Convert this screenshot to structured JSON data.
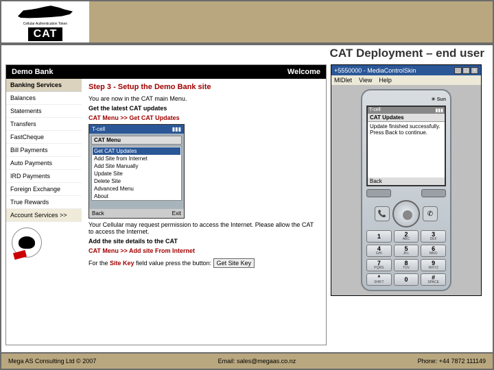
{
  "logo": {
    "sub": "Cellular Authentication Token",
    "text": "CAT"
  },
  "title": "CAT Deployment – end user",
  "bank": {
    "name": "Demo Bank",
    "welcome": "Welcome",
    "nav_header": "Banking Services",
    "nav_items": [
      "Balances",
      "Statements",
      "Transfers",
      "FastCheque",
      "Bill Payments",
      "Auto Payments",
      "IRD Payments",
      "Foreign Exchange",
      "True Rewards",
      "Account Services  >>"
    ],
    "step_title": "Step 3 - Setup the Demo Bank site",
    "line1": "You are now in the CAT main Menu.",
    "line2": "Get the latest CAT updates",
    "link1_prefix": "CAT Menu >> ",
    "link1": "Get CAT Updates",
    "line3": "Your Cellular may request permission to access the Internet. Please allow the CAT to access the Internet.",
    "line4": "Add the site details to the CAT",
    "link2_prefix": "CAT Menu >> ",
    "link2": "Add site From Internet",
    "sitekey_prefix": "For the ",
    "sitekey_bold": "Site Key",
    "sitekey_suffix": " field value press the button:",
    "sitekey_btn": "Get Site Key"
  },
  "mini_phone": {
    "title": "T-cell",
    "header": "CAT Menu",
    "items": [
      "Get CAT Updates",
      "Add Site from Internet",
      "Add Site Manually",
      "Update Site",
      "Delete Site",
      "Advanced Menu",
      "About"
    ],
    "soft_left": "Back",
    "soft_right": "Exit"
  },
  "emulator": {
    "win_title": "+5550000 - MediaControlSkin",
    "menu": [
      "MIDlet",
      "View",
      "Help"
    ],
    "sun": "Sun",
    "status_left": "T-cell",
    "screen_title": "CAT Updates",
    "screen_body": "Update finished successfully.\nPress Back to continue.",
    "soft_left": "Back",
    "keys": [
      {
        "n": "1",
        "l": ""
      },
      {
        "n": "2",
        "l": "ABC"
      },
      {
        "n": "3",
        "l": "DEF"
      },
      {
        "n": "4",
        "l": "GHI"
      },
      {
        "n": "5",
        "l": "JKL"
      },
      {
        "n": "6",
        "l": "MNO"
      },
      {
        "n": "7",
        "l": "PQRS"
      },
      {
        "n": "8",
        "l": "TUV"
      },
      {
        "n": "9",
        "l": "WXYZ"
      },
      {
        "n": "*",
        "l": "SHIFT"
      },
      {
        "n": "0",
        "l": ""
      },
      {
        "n": "#",
        "l": "SPACE"
      }
    ],
    "call_icon": "📞",
    "end_icon": "✆"
  },
  "footer": {
    "left": "Mega AS Consulting Ltd © 2007",
    "email": "Email: sales@megaas.co.nz",
    "phone": "Phone: +44 7872 111149"
  }
}
